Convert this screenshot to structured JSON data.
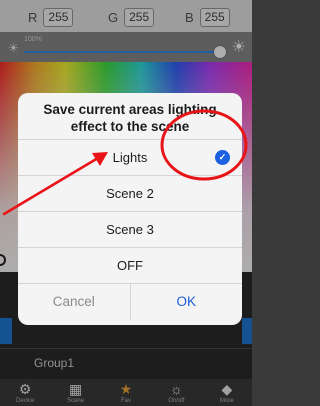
{
  "rgb": {
    "r_label": "R",
    "r_value": "255",
    "g_label": "G",
    "g_value": "255",
    "b_label": "B",
    "b_value": "255"
  },
  "brightness": {
    "percent_label": "100%",
    "level": 1.0
  },
  "dialog": {
    "title": "Save current areas lighting effect to the scene",
    "options": [
      "Lights",
      "Scene 2",
      "Scene 3",
      "OFF"
    ],
    "selected_index": 0,
    "cancel_label": "Cancel",
    "ok_label": "OK"
  },
  "group_label": "Group1",
  "tabbar": {
    "items": [
      {
        "icon": "gear-icon",
        "label": "Device"
      },
      {
        "icon": "grid-icon",
        "label": "Scene"
      },
      {
        "icon": "star-icon",
        "label": "Fav"
      },
      {
        "icon": "bulb-icon",
        "label": "On/off"
      },
      {
        "icon": "cube-icon",
        "label": "More"
      }
    ],
    "active_index": 2
  },
  "colors": {
    "accent": "#1a5ddb",
    "annotation": "#e8141a",
    "active_tab": "#f0a53a"
  }
}
